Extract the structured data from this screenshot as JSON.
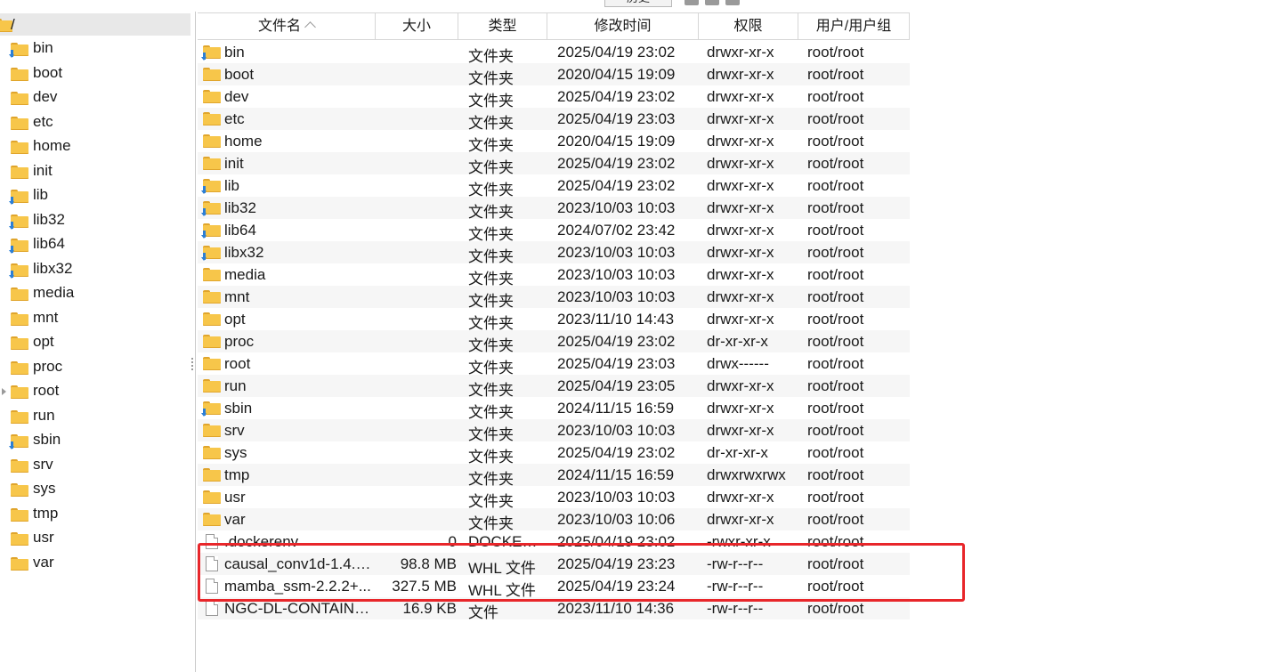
{
  "toolbar": {
    "history_label": "历史"
  },
  "tree": {
    "root": {
      "label": "/"
    },
    "items": [
      {
        "label": "bin",
        "link": true
      },
      {
        "label": "boot",
        "link": false
      },
      {
        "label": "dev",
        "link": false
      },
      {
        "label": "etc",
        "link": false
      },
      {
        "label": "home",
        "link": false
      },
      {
        "label": "init",
        "link": false
      },
      {
        "label": "lib",
        "link": true
      },
      {
        "label": "lib32",
        "link": true
      },
      {
        "label": "lib64",
        "link": true
      },
      {
        "label": "libx32",
        "link": true
      },
      {
        "label": "media",
        "link": false
      },
      {
        "label": "mnt",
        "link": false
      },
      {
        "label": "opt",
        "link": false
      },
      {
        "label": "proc",
        "link": false
      },
      {
        "label": "root",
        "link": false,
        "expandable": true
      },
      {
        "label": "run",
        "link": false
      },
      {
        "label": "sbin",
        "link": true
      },
      {
        "label": "srv",
        "link": false
      },
      {
        "label": "sys",
        "link": false
      },
      {
        "label": "tmp",
        "link": false
      },
      {
        "label": "usr",
        "link": false
      },
      {
        "label": "var",
        "link": false
      }
    ]
  },
  "filelist": {
    "columns": {
      "name": "文件名",
      "size": "大小",
      "type": "类型",
      "mtime": "修改时间",
      "perm": "权限",
      "owner": "用户/用户组"
    },
    "rows": [
      {
        "name": "bin",
        "size": "",
        "type": "文件夹",
        "mtime": "2025/04/19 23:02",
        "perm": "drwxr-xr-x",
        "owner": "root/root",
        "kind": "folder",
        "link": true
      },
      {
        "name": "boot",
        "size": "",
        "type": "文件夹",
        "mtime": "2020/04/15 19:09",
        "perm": "drwxr-xr-x",
        "owner": "root/root",
        "kind": "folder",
        "link": false
      },
      {
        "name": "dev",
        "size": "",
        "type": "文件夹",
        "mtime": "2025/04/19 23:02",
        "perm": "drwxr-xr-x",
        "owner": "root/root",
        "kind": "folder",
        "link": false
      },
      {
        "name": "etc",
        "size": "",
        "type": "文件夹",
        "mtime": "2025/04/19 23:03",
        "perm": "drwxr-xr-x",
        "owner": "root/root",
        "kind": "folder",
        "link": false
      },
      {
        "name": "home",
        "size": "",
        "type": "文件夹",
        "mtime": "2020/04/15 19:09",
        "perm": "drwxr-xr-x",
        "owner": "root/root",
        "kind": "folder",
        "link": false
      },
      {
        "name": "init",
        "size": "",
        "type": "文件夹",
        "mtime": "2025/04/19 23:02",
        "perm": "drwxr-xr-x",
        "owner": "root/root",
        "kind": "folder",
        "link": false
      },
      {
        "name": "lib",
        "size": "",
        "type": "文件夹",
        "mtime": "2025/04/19 23:02",
        "perm": "drwxr-xr-x",
        "owner": "root/root",
        "kind": "folder",
        "link": true
      },
      {
        "name": "lib32",
        "size": "",
        "type": "文件夹",
        "mtime": "2023/10/03 10:03",
        "perm": "drwxr-xr-x",
        "owner": "root/root",
        "kind": "folder",
        "link": true
      },
      {
        "name": "lib64",
        "size": "",
        "type": "文件夹",
        "mtime": "2024/07/02 23:42",
        "perm": "drwxr-xr-x",
        "owner": "root/root",
        "kind": "folder",
        "link": true
      },
      {
        "name": "libx32",
        "size": "",
        "type": "文件夹",
        "mtime": "2023/10/03 10:03",
        "perm": "drwxr-xr-x",
        "owner": "root/root",
        "kind": "folder",
        "link": true
      },
      {
        "name": "media",
        "size": "",
        "type": "文件夹",
        "mtime": "2023/10/03 10:03",
        "perm": "drwxr-xr-x",
        "owner": "root/root",
        "kind": "folder",
        "link": false
      },
      {
        "name": "mnt",
        "size": "",
        "type": "文件夹",
        "mtime": "2023/10/03 10:03",
        "perm": "drwxr-xr-x",
        "owner": "root/root",
        "kind": "folder",
        "link": false
      },
      {
        "name": "opt",
        "size": "",
        "type": "文件夹",
        "mtime": "2023/11/10 14:43",
        "perm": "drwxr-xr-x",
        "owner": "root/root",
        "kind": "folder",
        "link": false
      },
      {
        "name": "proc",
        "size": "",
        "type": "文件夹",
        "mtime": "2025/04/19 23:02",
        "perm": "dr-xr-xr-x",
        "owner": "root/root",
        "kind": "folder",
        "link": false
      },
      {
        "name": "root",
        "size": "",
        "type": "文件夹",
        "mtime": "2025/04/19 23:03",
        "perm": "drwx------",
        "owner": "root/root",
        "kind": "folder",
        "link": false
      },
      {
        "name": "run",
        "size": "",
        "type": "文件夹",
        "mtime": "2025/04/19 23:05",
        "perm": "drwxr-xr-x",
        "owner": "root/root",
        "kind": "folder",
        "link": false
      },
      {
        "name": "sbin",
        "size": "",
        "type": "文件夹",
        "mtime": "2024/11/15 16:59",
        "perm": "drwxr-xr-x",
        "owner": "root/root",
        "kind": "folder",
        "link": true
      },
      {
        "name": "srv",
        "size": "",
        "type": "文件夹",
        "mtime": "2023/10/03 10:03",
        "perm": "drwxr-xr-x",
        "owner": "root/root",
        "kind": "folder",
        "link": false
      },
      {
        "name": "sys",
        "size": "",
        "type": "文件夹",
        "mtime": "2025/04/19 23:02",
        "perm": "dr-xr-xr-x",
        "owner": "root/root",
        "kind": "folder",
        "link": false
      },
      {
        "name": "tmp",
        "size": "",
        "type": "文件夹",
        "mtime": "2024/11/15 16:59",
        "perm": "drwxrwxrwx",
        "owner": "root/root",
        "kind": "folder",
        "link": false
      },
      {
        "name": "usr",
        "size": "",
        "type": "文件夹",
        "mtime": "2023/10/03 10:03",
        "perm": "drwxr-xr-x",
        "owner": "root/root",
        "kind": "folder",
        "link": false
      },
      {
        "name": "var",
        "size": "",
        "type": "文件夹",
        "mtime": "2023/10/03 10:06",
        "perm": "drwxr-xr-x",
        "owner": "root/root",
        "kind": "folder",
        "link": false
      },
      {
        "name": ".dockerenv",
        "size": "0",
        "type": "DOCKERE...",
        "mtime": "2025/04/19 23:02",
        "perm": "-rwxr-xr-x",
        "owner": "root/root",
        "kind": "file",
        "link": false
      },
      {
        "name": "causal_conv1d-1.4.0...",
        "size": "98.8 MB",
        "type": "WHL 文件",
        "mtime": "2025/04/19 23:23",
        "perm": "-rw-r--r--",
        "owner": "root/root",
        "kind": "file",
        "link": false
      },
      {
        "name": "mamba_ssm-2.2.2+...",
        "size": "327.5 MB",
        "type": "WHL 文件",
        "mtime": "2025/04/19 23:24",
        "perm": "-rw-r--r--",
        "owner": "root/root",
        "kind": "file",
        "link": false
      },
      {
        "name": "NGC-DL-CONTAINE...",
        "size": "16.9 KB",
        "type": "文件",
        "mtime": "2023/11/10 14:36",
        "perm": "-rw-r--r--",
        "owner": "root/root",
        "kind": "file",
        "link": false
      }
    ]
  },
  "colors": {
    "highlight": "#e8262a",
    "folder": "#f7c64a",
    "link_arrow": "#2c7fd6",
    "row_alt": "#f6f6f6"
  }
}
